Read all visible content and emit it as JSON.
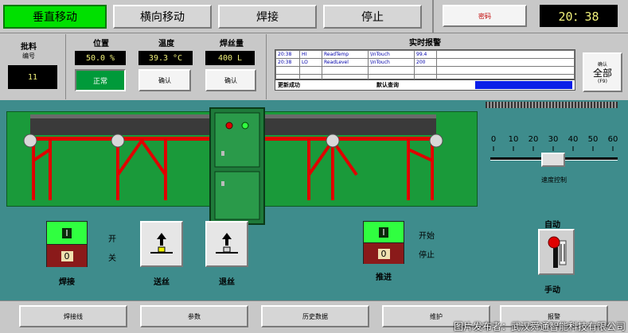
{
  "top_tabs": [
    {
      "label": "垂直移动",
      "active": true
    },
    {
      "label": "横向移动",
      "active": false
    },
    {
      "label": "焊接",
      "active": false
    },
    {
      "label": "停止",
      "active": false
    }
  ],
  "password_label": "密码",
  "clock": "20：38",
  "batch": {
    "label1": "批料",
    "label2": "编号",
    "value": "11"
  },
  "position": {
    "label": "位置",
    "value": "50.0 %",
    "status": "正常"
  },
  "temperature": {
    "label": "温度",
    "value": "39.3 °C",
    "confirm": "确认"
  },
  "wire": {
    "label": "焊丝量",
    "value": "400 L",
    "confirm": "确认"
  },
  "alarm": {
    "title": "实时报警",
    "rows": [
      [
        "20:38",
        "HI",
        "ReadTemp",
        "\\InTouch",
        "99.4"
      ],
      [
        "20:38",
        "LO",
        "ReadLevel",
        "\\InTouch",
        "200"
      ],
      [
        "",
        "",
        "",
        "",
        ""
      ],
      [
        "",
        "",
        "",
        "",
        ""
      ]
    ],
    "status_update": "更新成功",
    "status_query": "默认查询"
  },
  "confirm_all": {
    "small": "确认",
    "big": "全部",
    "key": "(F9)"
  },
  "speed": {
    "ticks": [
      "0",
      "10",
      "20",
      "30",
      "40",
      "50",
      "60"
    ],
    "value": 30,
    "label": "速度控制"
  },
  "controls": {
    "weld": {
      "label": "焊接",
      "on": "I",
      "off": "0"
    },
    "switch_on": "开",
    "switch_off": "关",
    "feed": {
      "label": "送丝"
    },
    "retract": {
      "label": "退丝"
    },
    "push": {
      "label": "推进",
      "on": "I",
      "off": "0"
    },
    "start": "开始",
    "stop": "停止",
    "auto": "自动",
    "manual": "手动"
  },
  "bottom_buttons": [
    "焊接线",
    "参数",
    "历史数据",
    "维护",
    "报警"
  ],
  "watermark": "图片发布者：武汉舜通智能科技有限公司",
  "colors": {
    "active_tab": "#00e000",
    "teal": "#3e8c8c",
    "green_area": "#1a9a3a",
    "red": "#e00000"
  }
}
